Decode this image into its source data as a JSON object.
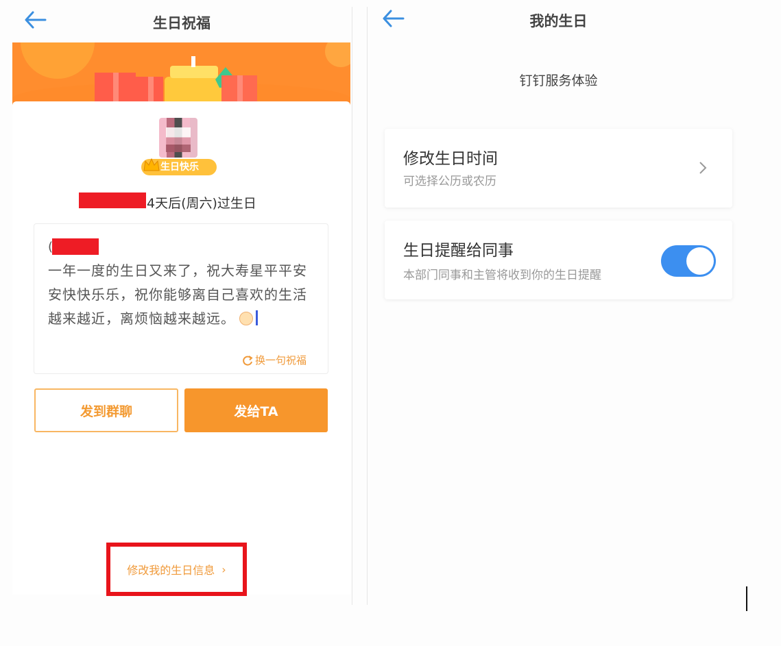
{
  "left": {
    "title": "生日祝福",
    "badge": "生日快乐",
    "birthday_line": "4天后(周六)过生日",
    "paren": "(",
    "message": "一年一度的生日又来了，祝大寿星平平安安快快乐乐，祝你能够离自己喜欢的生活越来越近，离烦恼越来越远。",
    "swap_label": "换一句祝福",
    "btn_group": "发到群聊",
    "btn_send": "发给TA",
    "edit_label": "修改我的生日信息",
    "edit_chevron": "›"
  },
  "right": {
    "title": "我的生日",
    "subtitle": "钉钉服务体验",
    "row1": {
      "title": "修改生日时间",
      "sub": "可选择公历或农历"
    },
    "row2": {
      "title": "生日提醒给同事",
      "sub": "本部门同事和主管将收到你的生日提醒",
      "toggle_on": true
    }
  },
  "colors": {
    "accent_orange": "#f7962c",
    "toggle_blue": "#3c8ff0",
    "highlight_red": "#e8141b",
    "back_blue": "#3b8fe0"
  },
  "icons": [
    "back-arrow-icon",
    "crown-icon",
    "refresh-icon",
    "chevron-right-icon",
    "cake-emoji-icon"
  ]
}
